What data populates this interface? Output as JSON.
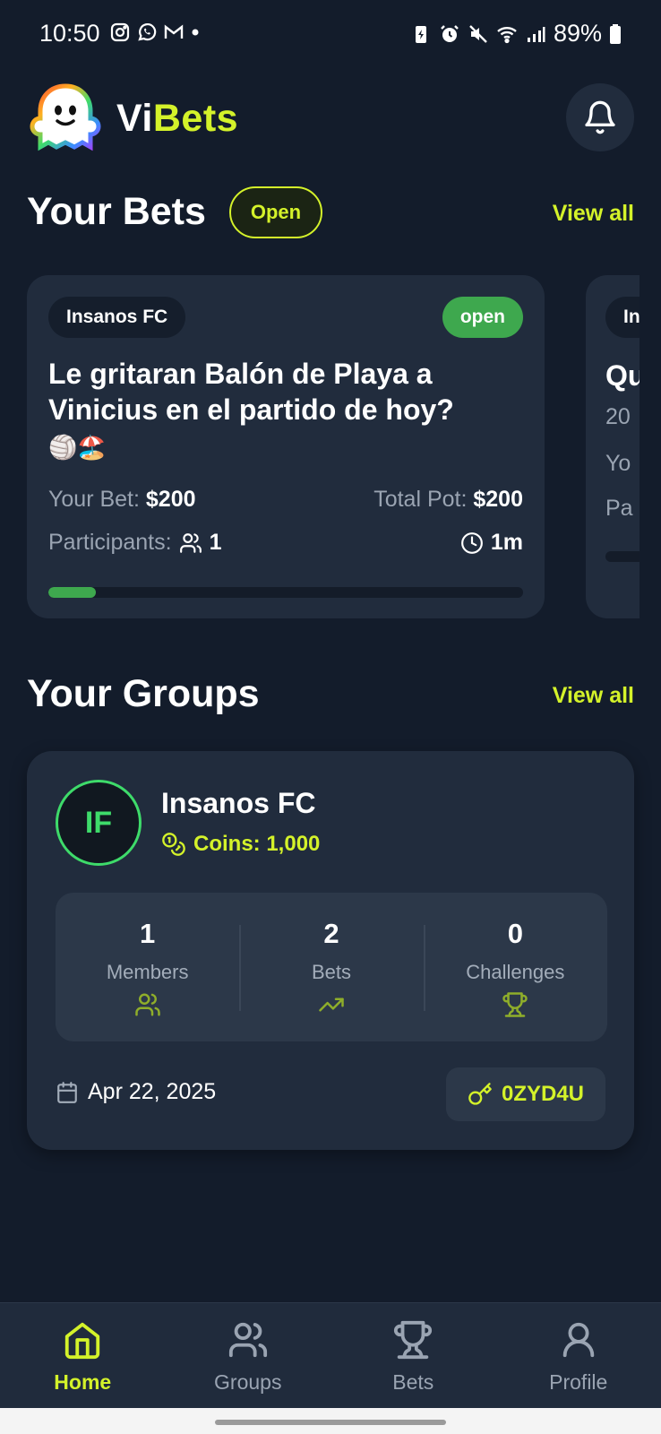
{
  "status_bar": {
    "time": "10:50",
    "battery": "89%",
    "left_icons": [
      "instagram-icon",
      "whatsapp-icon",
      "gmail-icon",
      "dot-icon"
    ],
    "right_icons": [
      "battery-saver-icon",
      "alarm-icon",
      "mute-icon",
      "wifi-icon",
      "signal-icon",
      "battery-icon"
    ]
  },
  "header": {
    "brand_vi": "Vi",
    "brand_bets": "Bets",
    "bell_icon": "bell-icon"
  },
  "your_bets": {
    "title": "Your Bets",
    "filter": "Open",
    "view_all": "View all",
    "cards": [
      {
        "group": "Insanos FC",
        "status": "open",
        "question": "Le gritaran Balón de Playa a Vinicius en el partido de hoy?",
        "emoji": "🏐🏖️",
        "your_bet_label": "Your Bet:",
        "your_bet": "$200",
        "total_pot_label": "Total Pot:",
        "total_pot": "$200",
        "participants_label": "Participants:",
        "participants": "1",
        "time_left": "1m",
        "progress": 0.1
      },
      {
        "group": "In",
        "question": "Qu",
        "line2": "20",
        "line3": "Yo",
        "line4": "Pa"
      }
    ]
  },
  "your_groups": {
    "title": "Your Groups",
    "view_all": "View all",
    "group": {
      "initials": "IF",
      "name": "Insanos FC",
      "coins": "Coins: 1,000",
      "stats": [
        {
          "value": "1",
          "label": "Members",
          "icon": "users-icon"
        },
        {
          "value": "2",
          "label": "Bets",
          "icon": "trending-up-icon"
        },
        {
          "value": "0",
          "label": "Challenges",
          "icon": "trophy-icon"
        }
      ],
      "date": "Apr 22, 2025",
      "code": "0ZYD4U"
    }
  },
  "bottom_nav": [
    {
      "label": "Home",
      "icon": "home-icon",
      "active": true
    },
    {
      "label": "Groups",
      "icon": "users-icon",
      "active": false
    },
    {
      "label": "Bets",
      "icon": "trophy-icon",
      "active": false
    },
    {
      "label": "Profile",
      "icon": "user-icon",
      "active": false
    }
  ],
  "colors": {
    "background": "#131c2b",
    "card": "#212c3d",
    "accent": "#d4f22a",
    "open_green": "#3ea84e",
    "avatar_green": "#3edb6a"
  }
}
